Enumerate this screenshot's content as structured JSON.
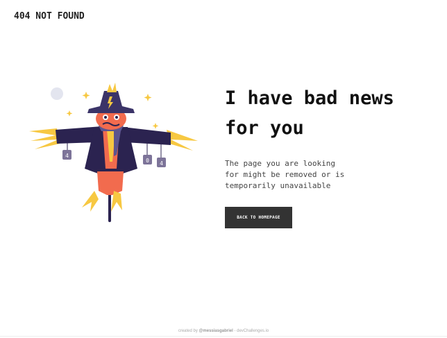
{
  "header": {
    "brand": "404 NOT FOUND"
  },
  "hero": {
    "headline_line1": "I have bad news",
    "headline_line2": "for you",
    "subtitle_line1": "The page you are looking",
    "subtitle_line2": "for might be removed or is",
    "subtitle_line3": "temporarily unavailable",
    "cta_label": "BACK TO HOMEPAGE",
    "tag_digits": [
      "4",
      "0",
      "4"
    ]
  },
  "footer": {
    "prefix": "created by",
    "author": "@messiasgabriel",
    "suffix": "- devChallenges.io"
  },
  "colors": {
    "button_bg": "#333333",
    "coat": "#2b2350",
    "face": "#f26b4e",
    "straw": "#f7c842",
    "hat": "#3b3468"
  }
}
